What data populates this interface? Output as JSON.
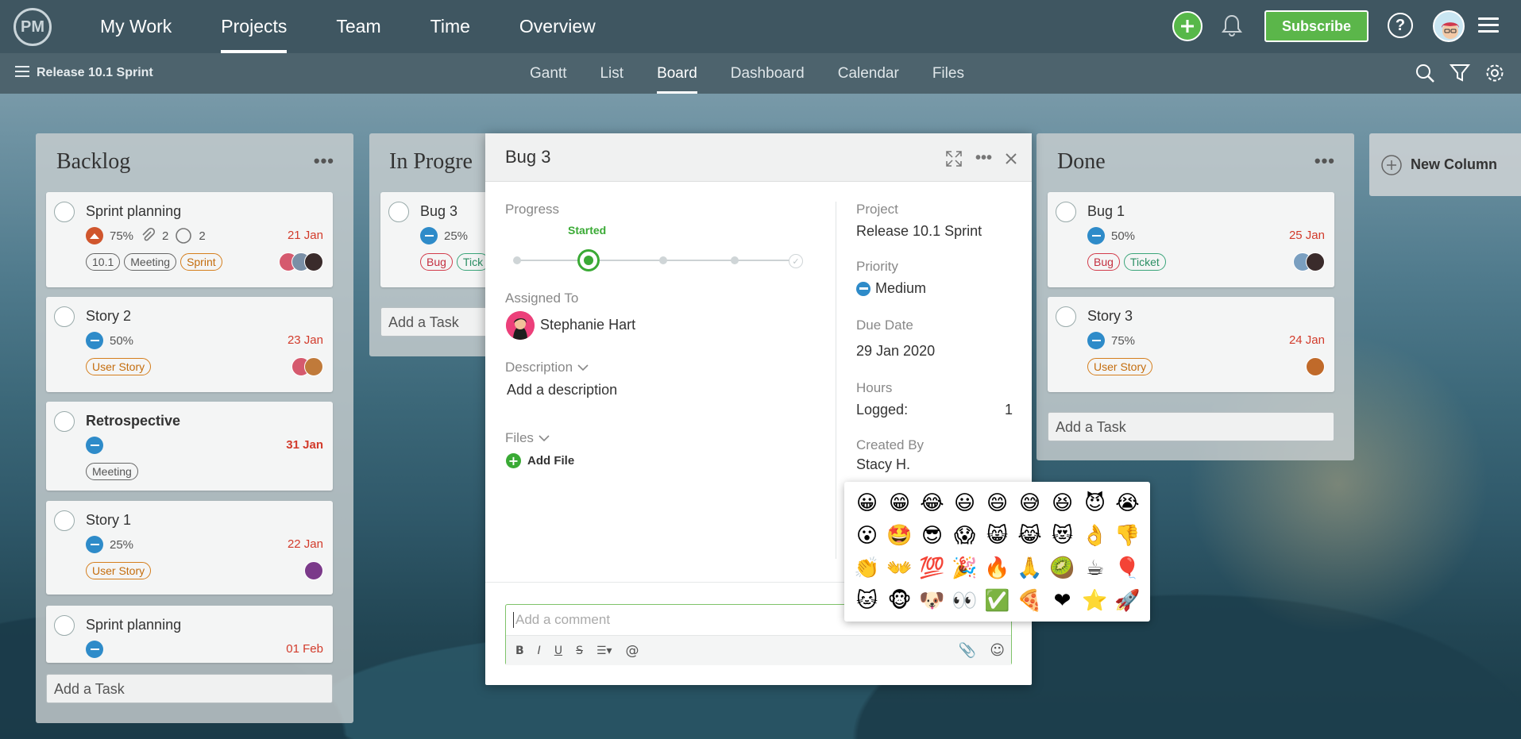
{
  "topnav": {
    "logo": "PM",
    "items": [
      "My Work",
      "Projects",
      "Team",
      "Time",
      "Overview"
    ],
    "active": "Projects",
    "subscribe": "Subscribe",
    "help": "?"
  },
  "subbar": {
    "project": "Release 10.1 Sprint",
    "views": [
      "Gantt",
      "List",
      "Board",
      "Dashboard",
      "Calendar",
      "Files"
    ],
    "active_view": "Board"
  },
  "columns": {
    "backlog": {
      "title": "Backlog",
      "add_task": "Add a Task",
      "cards": [
        {
          "title": "Sprint planning",
          "progress": "75%",
          "attachments": "2",
          "comments": "2",
          "due": "21 Jan",
          "tags": [
            "10.1",
            "Meeting",
            "Sprint"
          ]
        },
        {
          "title": "Story 2",
          "progress": "50%",
          "due": "23 Jan",
          "tags": [
            "User Story"
          ]
        },
        {
          "title": "Retrospective",
          "due": "31 Jan",
          "tags": [
            "Meeting"
          ]
        },
        {
          "title": "Story 1",
          "progress": "25%",
          "due": "22 Jan",
          "tags": [
            "User Story"
          ]
        },
        {
          "title": "Sprint planning",
          "due": "01 Feb"
        }
      ]
    },
    "inprogress": {
      "title": "In Progre",
      "add_task": "Add a Task",
      "cards": [
        {
          "title": "Bug 3",
          "progress": "25%",
          "tags": [
            "Bug",
            "Tick"
          ]
        }
      ]
    },
    "done": {
      "title": "Done",
      "add_task": "Add a Task",
      "cards": [
        {
          "title": "Bug 1",
          "progress": "50%",
          "due": "25 Jan",
          "tags": [
            "Bug",
            "Ticket"
          ]
        },
        {
          "title": "Story 3",
          "progress": "75%",
          "due": "24 Jan",
          "tags": [
            "User Story"
          ]
        }
      ]
    }
  },
  "new_column": "New Column",
  "modal": {
    "title": "Bug 3",
    "progress_label": "Progress",
    "progress_state": "Started",
    "assigned_label": "Assigned To",
    "assignee": "Stephanie Hart",
    "description_label": "Description",
    "description_placeholder": "Add a description",
    "files_label": "Files",
    "add_file": "Add File",
    "project_label": "Project",
    "project": "Release 10.1 Sprint",
    "priority_label": "Priority",
    "priority": "Medium",
    "due_label": "Due Date",
    "due": "29 Jan 2020",
    "hours_label": "Hours",
    "logged_label": "Logged:",
    "logged": "1",
    "created_label": "Created By",
    "created_by": "Stacy H.",
    "comment_placeholder": "Add a comment"
  },
  "emoji_picker": [
    "😀",
    "😁",
    "😂",
    "😃",
    "😄",
    "😅",
    "😆",
    "😈",
    "😭",
    "😮",
    "🤩",
    "😎",
    "😱",
    "😸",
    "😹",
    "😻",
    "👌",
    "👎",
    "👏",
    "👐",
    "💯",
    "🎉",
    "🔥",
    "🙏",
    "🥝",
    "☕",
    "🎈",
    "🐱",
    "🐵",
    "🐶",
    "👀",
    "✅",
    "🍕",
    "❤",
    "⭐",
    "🚀"
  ],
  "colors": {
    "accent_green": "#5bb64a",
    "priority_blue": "#2e8bc9",
    "due_red": "#d23b2b"
  }
}
